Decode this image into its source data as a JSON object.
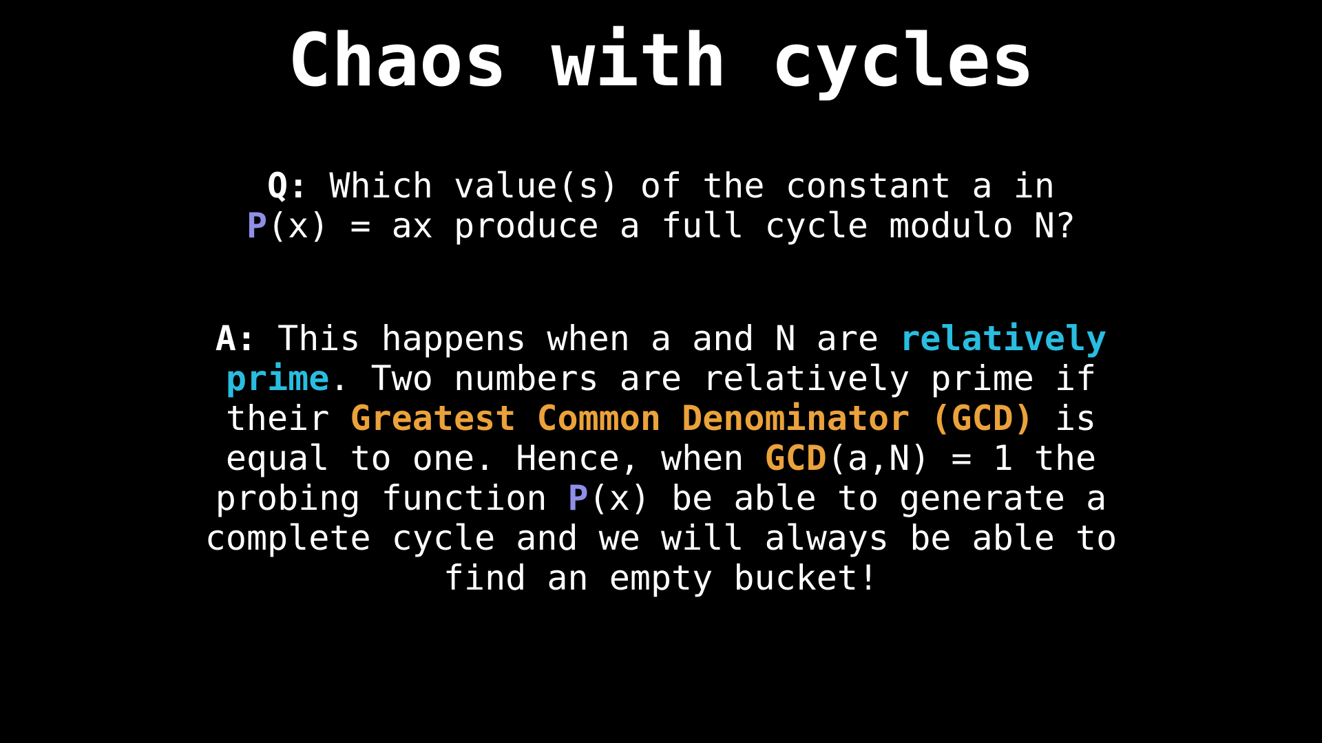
{
  "slide": {
    "title": "Chaos with cycles",
    "colors": {
      "background": "#000000",
      "text": "#ffffff",
      "probe_function": "#8f8fe8",
      "relatively_prime": "#29bde0",
      "gcd": "#eba23c"
    },
    "question": {
      "label": "Q:",
      "line1_text": " Which value(s) of the constant a in",
      "fn_name": "P",
      "line2_text": "(x) = ax produce a full cycle modulo N?"
    },
    "answer": {
      "label": "A:",
      "line1_text": " This happens when a and N are ",
      "highlight_rel1": "relatively",
      "highlight_rel2": "prime",
      "line2_text": ". Two numbers are relatively prime if",
      "line3_pre": "their ",
      "highlight_gcd_full": "Greatest Common Denominator (GCD)",
      "line3_post": " is",
      "line4_pre": "equal to one. Hence, when ",
      "highlight_gcd": "GCD",
      "line4_post": "(a,N) = 1 the",
      "line5_pre": "probing function ",
      "fn_name": "P",
      "line5_post": "(x) be able to generate a",
      "line6": "complete cycle and we will always be able to",
      "line7": "find an empty bucket!"
    }
  }
}
